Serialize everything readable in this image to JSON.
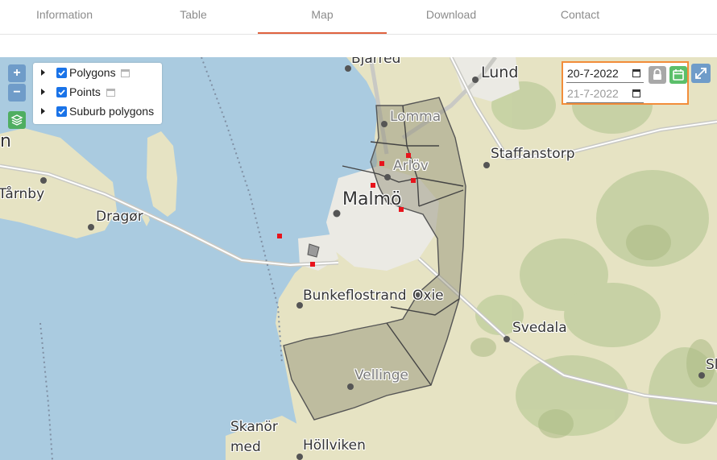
{
  "tabs": [
    {
      "label": "Information"
    },
    {
      "label": "Table"
    },
    {
      "label": "Map",
      "active": true
    },
    {
      "label": "Download"
    },
    {
      "label": "Contact"
    }
  ],
  "map_controls": {
    "zoom_in": "+",
    "zoom_out": "−",
    "layers_icon": "layers-icon"
  },
  "legend": {
    "items": [
      {
        "label": "Polygons",
        "checked": true,
        "has_calendar": true
      },
      {
        "label": "Points",
        "checked": true,
        "has_calendar": true
      },
      {
        "label": "Suburb polygons",
        "checked": true,
        "has_calendar": false
      }
    ]
  },
  "date_filter": {
    "from_value": "20-7-2022",
    "to_placeholder": "21-7-2022",
    "lock_icon": "lock-icon",
    "calendar_icon": "calendar-icon"
  },
  "expand_icon": "expand-icon",
  "places": [
    {
      "name": "Bjarred"
    },
    {
      "name": "Lund"
    },
    {
      "name": "Lomma"
    },
    {
      "name": "Staffanstorp"
    },
    {
      "name": "Arlöv"
    },
    {
      "name": "Malmö"
    },
    {
      "name": "Tårnby"
    },
    {
      "name": "Dragør"
    },
    {
      "name": "Bunkeflostrand"
    },
    {
      "name": "Oxie"
    },
    {
      "name": "Svedala"
    },
    {
      "name": "Vellinge"
    },
    {
      "name": "Skanör"
    },
    {
      "name": "med"
    },
    {
      "name": "Höllviken"
    },
    {
      "name": "Sl"
    },
    {
      "name": "n"
    }
  ],
  "colors": {
    "accent": "#e0623f",
    "water": "#aacbe0",
    "land": "#e6e3c3",
    "urban": "#e9e8e1",
    "polygon_fill": "#9f9a84",
    "point_marker": "#e8141c",
    "date_panel_border": "#f28d3a"
  }
}
